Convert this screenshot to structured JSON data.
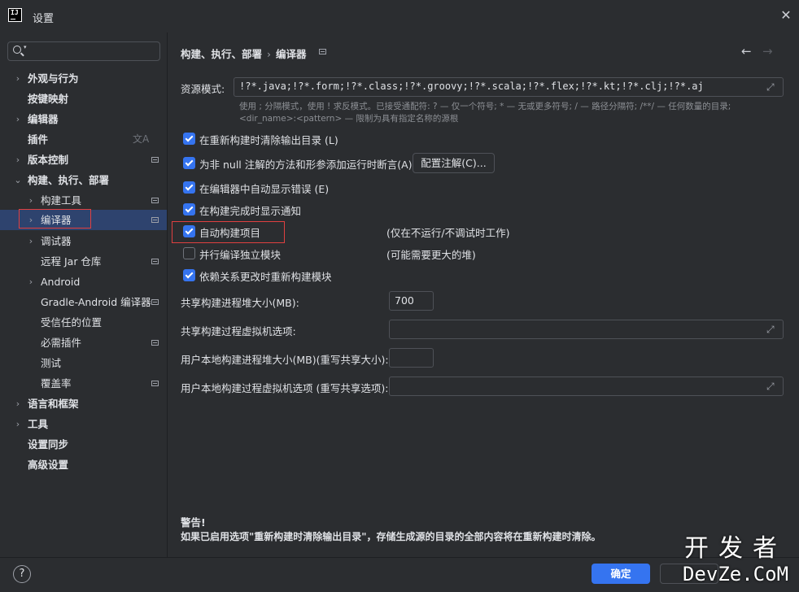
{
  "window": {
    "title": "设置",
    "logo_text": "IJ"
  },
  "search": {
    "placeholder": ""
  },
  "sidebar": {
    "items": [
      {
        "label": "外观与行为",
        "expand": "›"
      },
      {
        "label": "按键映射"
      },
      {
        "label": "编辑器",
        "expand": "›"
      },
      {
        "label": "插件"
      },
      {
        "label": "版本控制",
        "expand": "›"
      },
      {
        "label": "构建、执行、部署",
        "expand": "⌄"
      },
      {
        "label": "构建工具",
        "expand": "›"
      },
      {
        "label": "编译器",
        "expand": "›"
      },
      {
        "label": "调试器",
        "expand": "›"
      },
      {
        "label": "远程 Jar 仓库"
      },
      {
        "label": "Android",
        "expand": "›"
      },
      {
        "label": "Gradle-Android 编译器"
      },
      {
        "label": "受信任的位置"
      },
      {
        "label": "必需插件"
      },
      {
        "label": "测试"
      },
      {
        "label": "覆盖率"
      },
      {
        "label": "语言和框架",
        "expand": "›"
      },
      {
        "label": "工具",
        "expand": "›"
      },
      {
        "label": "设置同步"
      },
      {
        "label": "高级设置"
      }
    ]
  },
  "breadcrumb": {
    "parent": "构建、执行、部署",
    "separator": "›",
    "current": "编译器"
  },
  "resource_patterns": {
    "label": "资源模式:",
    "value": "!?*.java;!?*.form;!?*.class;!?*.groovy;!?*.scala;!?*.flex;!?*.kt;!?*.clj;!?*.aj",
    "hint_line1": "使用 ; 分隔模式，使用 ! 求反模式。已接受通配符: ? — 仅一个符号; * — 无或更多符号; / — 路径分隔符; /**/ — 任何数量的目录;",
    "hint_line2": "<dir_name>:<pattern> — 限制为具有指定名称的源根"
  },
  "options": {
    "clear_output": {
      "label": "在重新构建时清除输出目录 (L)",
      "checked": true
    },
    "add_assertions": {
      "label": "为非 null 注解的方法和形参添加运行时断言(A)",
      "checked": true
    },
    "configure_annotations": "配置注解(C)...",
    "auto_show_errors": {
      "label": "在编辑器中自动显示错误 (E)",
      "checked": true
    },
    "notify_done": {
      "label": "在构建完成时显示通知",
      "checked": true
    },
    "auto_build": {
      "label": "自动构建项目",
      "checked": true,
      "note": "(仅在不运行/不调试时工作)"
    },
    "parallel": {
      "label": "并行编译独立模块",
      "checked": false,
      "note": "(可能需要更大的堆)"
    },
    "rebuild_on_dep": {
      "label": "依赖关系更改时重新构建模块",
      "checked": true
    }
  },
  "heap": {
    "shared_label": "共享构建进程堆大小(MB):",
    "shared_value": "700",
    "shared_vm_label": "共享构建过程虚拟机选项:",
    "user_heap_label": "用户本地构建进程堆大小(MB)(重写共享大小):",
    "user_vm_label": "用户本地构建过程虚拟机选项 (重写共享选项):"
  },
  "warning": {
    "title": "警告!",
    "body": "如果已启用选项\"重新构建时清除输出目录\"，存储生成源的目录的全部内容将在重新构建时清除。"
  },
  "footer": {
    "help": "?",
    "ok": "确定"
  },
  "watermark": {
    "line1": "开发者",
    "line2": "DevZe.CoM"
  },
  "colors": {
    "accent": "#3574f0",
    "selection": "#2e436e",
    "highlight": "#e04040",
    "background": "#2b2d30"
  }
}
